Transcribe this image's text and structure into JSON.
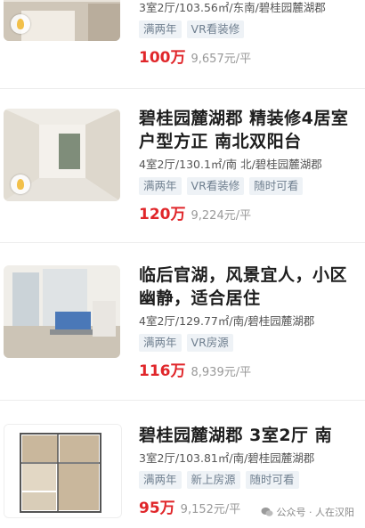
{
  "listings": [
    {
      "title": "",
      "meta": "3室2厅/103.56㎡/东南/碧桂园麓湖郡",
      "tags": [
        "满两年",
        "VR看装修"
      ],
      "price": "100万",
      "unit_price": "9,657元/平"
    },
    {
      "title": "碧桂园麓湖郡 精装修4居室 户型方正 南北双阳台",
      "meta": "4室2厅/130.1㎡/南 北/碧桂园麓湖郡",
      "tags": [
        "满两年",
        "VR看装修",
        "随时可看"
      ],
      "price": "120万",
      "unit_price": "9,224元/平"
    },
    {
      "title": "临后官湖，风景宜人，小区幽静，适合居住",
      "meta": "4室2厅/129.77㎡/南/碧桂园麓湖郡",
      "tags": [
        "满两年",
        "VR房源"
      ],
      "price": "116万",
      "unit_price": "8,939元/平"
    },
    {
      "title": "碧桂园麓湖郡 3室2厅 南",
      "meta": "3室2厅/103.81㎡/南/碧桂园麓湖郡",
      "tags": [
        "满两年",
        "新上房源",
        "随时可看"
      ],
      "price": "95万",
      "unit_price": "9,152元/平"
    }
  ],
  "watermark": "公众号 · 人在汉阳",
  "colors": {
    "price": "#e0262a",
    "tag_bg": "#eef2f6",
    "tag_text": "#6f7f8f"
  }
}
